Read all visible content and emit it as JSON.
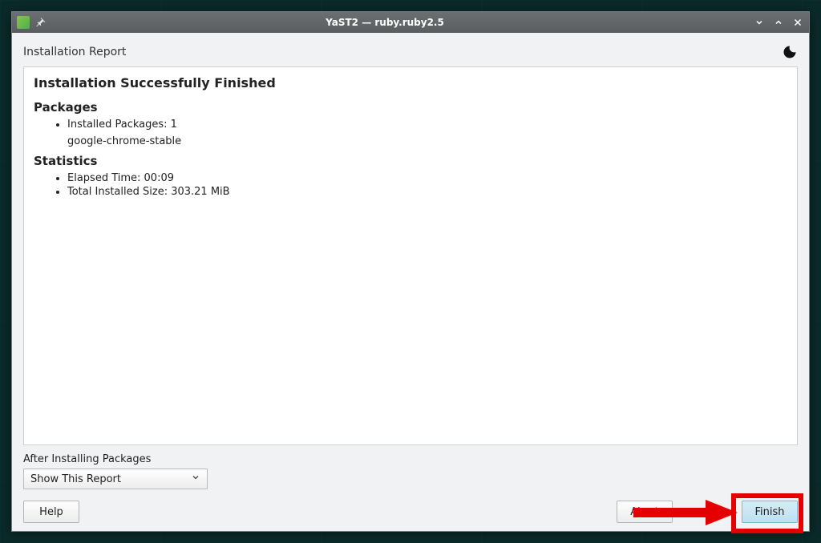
{
  "window": {
    "title": "YaST2 — ruby.ruby2.5"
  },
  "page": {
    "title": "Installation Report",
    "heading": "Installation Successfully Finished"
  },
  "packages": {
    "heading": "Packages",
    "installed_label": "Installed Packages: 1",
    "items": [
      "google-chrome-stable"
    ]
  },
  "statistics": {
    "heading": "Statistics",
    "elapsed": "Elapsed Time: 00:09",
    "total_size": "Total Installed Size: 303.21 MiB"
  },
  "after": {
    "label": "After Installing Packages",
    "selected": "Show This Report"
  },
  "buttons": {
    "help": "Help",
    "abort": "Abort",
    "finish": "Finish"
  }
}
